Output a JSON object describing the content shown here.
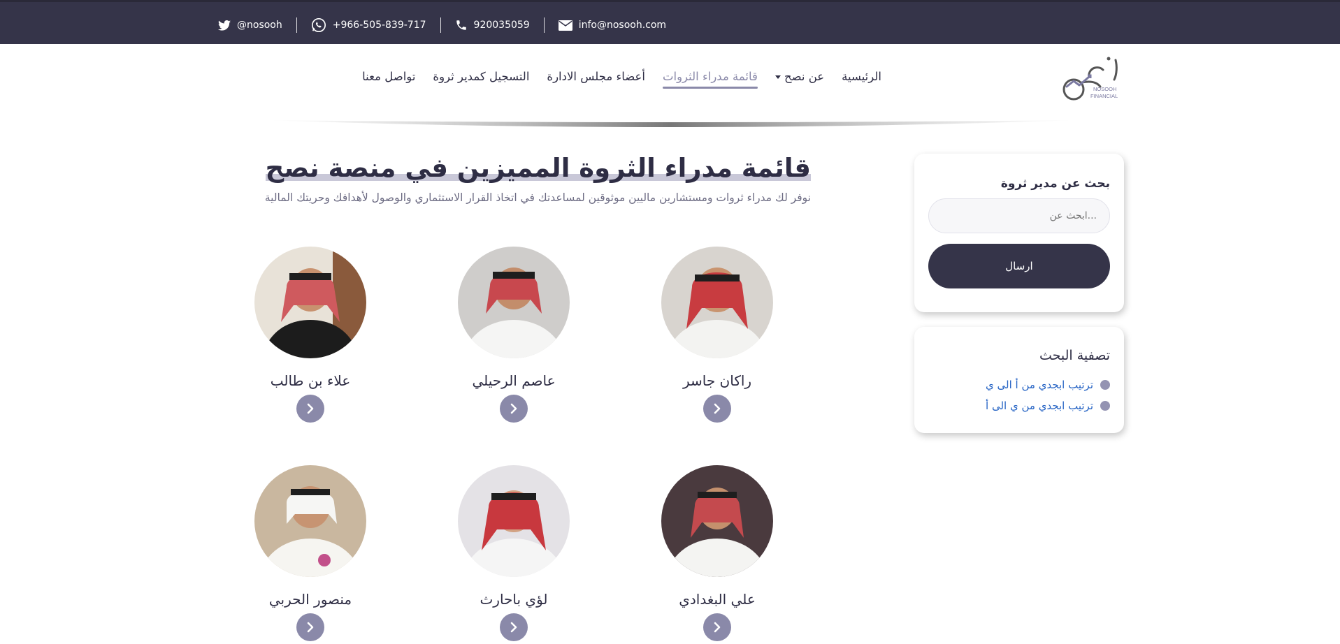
{
  "topbar": {
    "twitter": "@nosooh",
    "whatsapp": "+966-505-839-717",
    "phone": "920035059",
    "email": "info@nosooh.com"
  },
  "nav": {
    "items": [
      {
        "label": "الرئيسية"
      },
      {
        "label": "عن نصح"
      },
      {
        "label": "قائمة مدراء الثروات"
      },
      {
        "label": "أعضاء مجلس الادارة"
      },
      {
        "label": "التسجيل كمدير ثروة"
      },
      {
        "label": "تواصل معنا"
      }
    ]
  },
  "logo": {
    "brand_ar": "نصح",
    "brand_en_1": "NOSOOH",
    "brand_en_2": "FINANCIAL"
  },
  "main": {
    "title": "قائمة مدراء الثروة المميزين في منصة نصح",
    "subtitle": "نوفر لك مدراء ثروات ومستشارين ماليين موثوقين لمساعدتك في اتخاذ القرار الاستثماري والوصول لأهدافك وحريتك المالية"
  },
  "advisors": [
    {
      "name": "راكان جاسر"
    },
    {
      "name": "عاصم الرحيلي"
    },
    {
      "name": "علاء بن طالب"
    },
    {
      "name": "علي البغدادي"
    },
    {
      "name": "لؤي باحارث"
    },
    {
      "name": "منصور الحربي"
    }
  ],
  "sidebar": {
    "search_title": "بحث عن مدير ثروة",
    "search_placeholder": "...ابحث عن",
    "send_label": "ارسال",
    "filter_title": "تصفية البحث",
    "filter_options": [
      {
        "label": "ترتيب ابجدي من أ الى ي"
      },
      {
        "label": "ترتيب ابجدي من ي الى أ"
      }
    ]
  },
  "colors": {
    "dark": "#353449",
    "accent": "#8a89a9",
    "link": "#2563c4"
  }
}
